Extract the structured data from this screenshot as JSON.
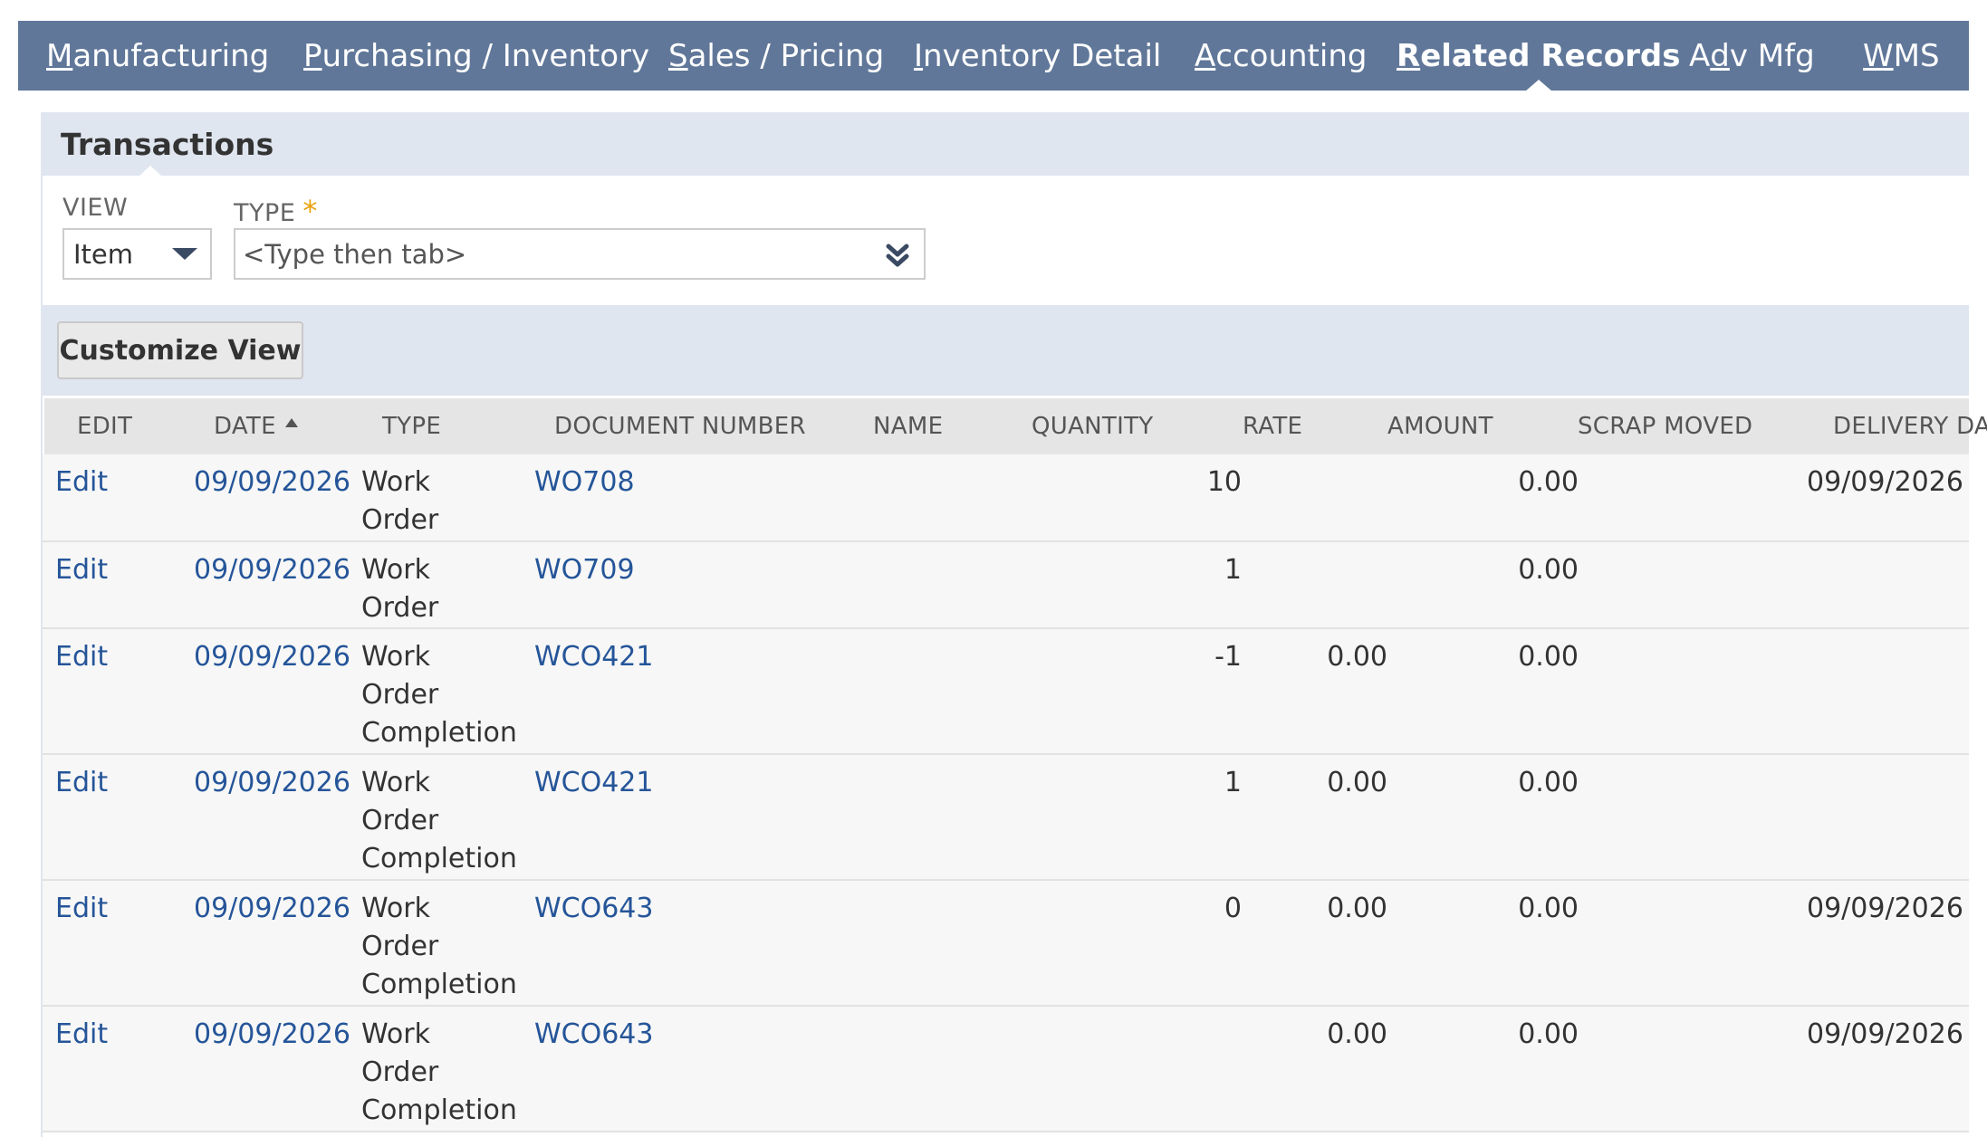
{
  "tabs": [
    {
      "pre": "",
      "ul": "M",
      "post": "anufacturing"
    },
    {
      "pre": "",
      "ul": "P",
      "post": "urchasing / Inventory"
    },
    {
      "pre": "",
      "ul": "S",
      "post": "ales / Pricing"
    },
    {
      "pre": "",
      "ul": "I",
      "post": "nventory Detail"
    },
    {
      "pre": "",
      "ul": "A",
      "post": "ccounting"
    },
    {
      "pre": "",
      "ul": "R",
      "post": "elated Records"
    },
    {
      "pre": "A",
      "ul": "d",
      "post": "v Mfg"
    },
    {
      "pre": "",
      "ul": "W",
      "post": "MS"
    }
  ],
  "active_tab_index": 5,
  "subtab": {
    "label": "Transactions"
  },
  "filters": {
    "view_label": "VIEW",
    "view_value": "Item",
    "type_label": "TYPE",
    "type_required_mark": "*",
    "type_placeholder": "<Type then tab>"
  },
  "toolbar": {
    "customize_label": "Customize View"
  },
  "columns": [
    "EDIT",
    "DATE",
    "TYPE",
    "DOCUMENT NUMBER",
    "NAME",
    "QUANTITY",
    "RATE",
    "AMOUNT",
    "SCRAP MOVED",
    "DELIVERY DATE"
  ],
  "sorted_column": "DATE",
  "rows": [
    {
      "edit": "Edit",
      "date": "09/09/2026",
      "type_lines": [
        "Work",
        "Order"
      ],
      "doc": "WO708",
      "name": "",
      "quantity": "10",
      "rate": "",
      "amount": "0.00",
      "scrap": "",
      "delivery": "09/09/2026"
    },
    {
      "edit": "Edit",
      "date": "09/09/2026",
      "type_lines": [
        "Work",
        "Order"
      ],
      "doc": "WO709",
      "name": "",
      "quantity": "1",
      "rate": "",
      "amount": "0.00",
      "scrap": "",
      "delivery": ""
    },
    {
      "edit": "Edit",
      "date": "09/09/2026",
      "type_lines": [
        "Work",
        "Order",
        "Completion"
      ],
      "doc": "WCO421",
      "name": "",
      "quantity": "-1",
      "rate": "0.00",
      "amount": "0.00",
      "scrap": "",
      "delivery": ""
    },
    {
      "edit": "Edit",
      "date": "09/09/2026",
      "type_lines": [
        "Work",
        "Order",
        "Completion"
      ],
      "doc": "WCO421",
      "name": "",
      "quantity": "1",
      "rate": "0.00",
      "amount": "0.00",
      "scrap": "",
      "delivery": ""
    },
    {
      "edit": "Edit",
      "date": "09/09/2026",
      "type_lines": [
        "Work",
        "Order",
        "Completion"
      ],
      "doc": "WCO643",
      "name": "",
      "quantity": "0",
      "rate": "0.00",
      "amount": "0.00",
      "scrap": "",
      "delivery": "09/09/2026"
    },
    {
      "edit": "Edit",
      "date": "09/09/2026",
      "type_lines": [
        "Work",
        "Order",
        "Completion"
      ],
      "doc": "WCO643",
      "name": "",
      "quantity": "",
      "rate": "0.00",
      "amount": "0.00",
      "scrap": "",
      "delivery": "09/09/2026"
    }
  ],
  "colors": {
    "tabbar": "#607799",
    "link": "#255599",
    "subtab_bg": "#e0e6ef",
    "required": "#e8a30c"
  }
}
